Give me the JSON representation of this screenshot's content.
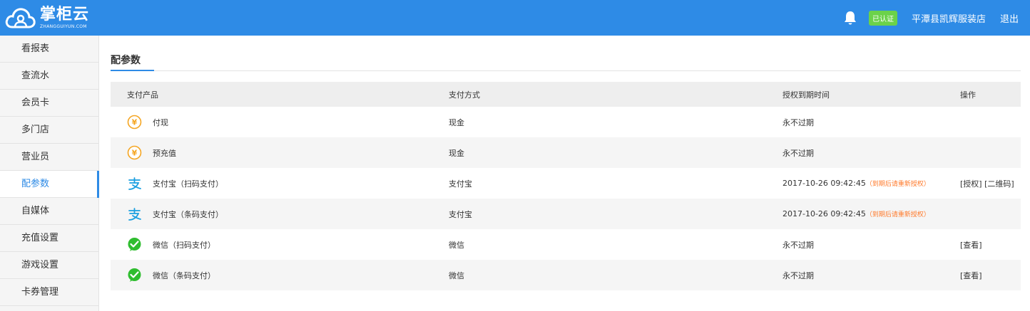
{
  "header": {
    "logo_cn": "掌柜云",
    "logo_en": "ZHANGGUIYUN.COM",
    "verified_badge": "已认证",
    "shop_name": "平潭县凯辉服装店",
    "logout": "退出"
  },
  "sidebar": {
    "items": [
      {
        "label": "看报表"
      },
      {
        "label": "查流水"
      },
      {
        "label": "会员卡"
      },
      {
        "label": "多门店"
      },
      {
        "label": "营业员"
      },
      {
        "label": "配参数",
        "active": true
      },
      {
        "label": "自媒体"
      },
      {
        "label": "充值设置"
      },
      {
        "label": "游戏设置"
      },
      {
        "label": "卡券管理"
      }
    ]
  },
  "page": {
    "tab": "配参数"
  },
  "table": {
    "headers": [
      "支付产品",
      "支付方式",
      "授权到期时间",
      "操作"
    ],
    "rows": [
      {
        "icon": "yuan-coin-icon",
        "product": "付现",
        "method": "现金",
        "expiry": "永不过期",
        "note": "",
        "action1": "",
        "action2": ""
      },
      {
        "icon": "yuan-coin-icon",
        "product": "预充值",
        "method": "现金",
        "expiry": "永不过期",
        "note": "",
        "action1": "",
        "action2": ""
      },
      {
        "icon": "alipay-icon",
        "product": "支付宝（扫码支付）",
        "method": "支付宝",
        "expiry": "2017-10-26 09:42:45",
        "note": "（到期后请重新授权）",
        "action1": "[授权]",
        "action2": "[二维码]"
      },
      {
        "icon": "alipay-icon",
        "product": "支付宝（条码支付）",
        "method": "支付宝",
        "expiry": "2017-10-26 09:42:45",
        "note": "（到期后请重新授权）",
        "action1": "",
        "action2": ""
      },
      {
        "icon": "wechat-icon",
        "product": "微信（扫码支付）",
        "method": "微信",
        "expiry": "永不过期",
        "note": "",
        "action1": "[查看]",
        "action2": ""
      },
      {
        "icon": "wechat-icon",
        "product": "微信（条码支付）",
        "method": "微信",
        "expiry": "永不过期",
        "note": "",
        "action1": "[查看]",
        "action2": ""
      }
    ]
  },
  "colors": {
    "primary": "#2e8be6",
    "badge": "#6bd24a",
    "note": "#ff7a2b",
    "coin": "#f5a623",
    "alipay": "#1a9fe0",
    "wechat": "#2fbd2f"
  }
}
